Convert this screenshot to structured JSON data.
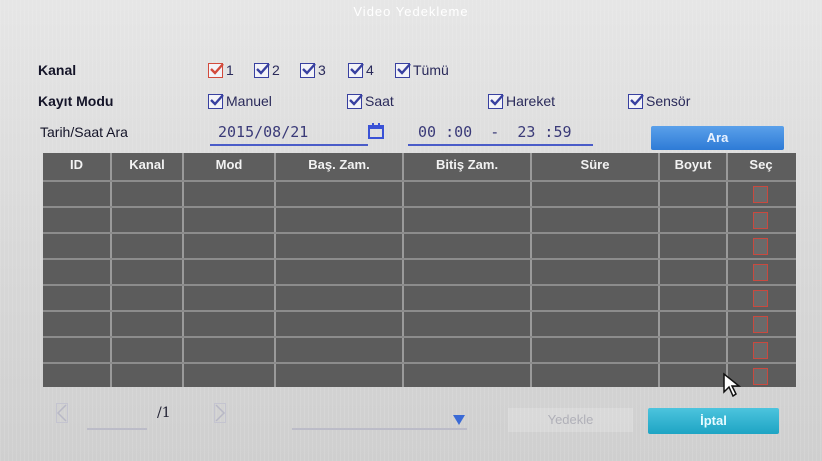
{
  "window": {
    "title": "Video Yedekleme"
  },
  "filters": {
    "channel_label": "Kanal",
    "channels": [
      {
        "label": "1",
        "checked": true
      },
      {
        "label": "2",
        "checked": true
      },
      {
        "label": "3",
        "checked": true
      },
      {
        "label": "4",
        "checked": true
      },
      {
        "label": "Tümü",
        "checked": true
      }
    ],
    "record_mode_label": "Kayıt Modu",
    "record_modes": [
      {
        "label": "Manuel",
        "checked": true
      },
      {
        "label": "Saat",
        "checked": true
      },
      {
        "label": "Hareket",
        "checked": true
      },
      {
        "label": "Sensör",
        "checked": true
      }
    ],
    "datetime_label": "Tarih/Saat Ara",
    "date": "2015/08/21",
    "time_range": "00 :00  -  23 :59",
    "search_button": "Ara"
  },
  "table": {
    "columns": [
      "ID",
      "Kanal",
      "Mod",
      "Baş. Zam.",
      "Bitiş Zam.",
      "Süre",
      "Boyut",
      "Seç"
    ],
    "rows": [],
    "empty_row_count": 8
  },
  "footer": {
    "page_total": "/1",
    "backup_button": "Yedekle",
    "cancel_button": "İptal"
  },
  "colors": {
    "accent_blue": "#2e7bd6",
    "cancel_cyan": "#1ea4c4",
    "checkbox_check": "#3840a0",
    "checkbox_red": "#d24a3c"
  }
}
